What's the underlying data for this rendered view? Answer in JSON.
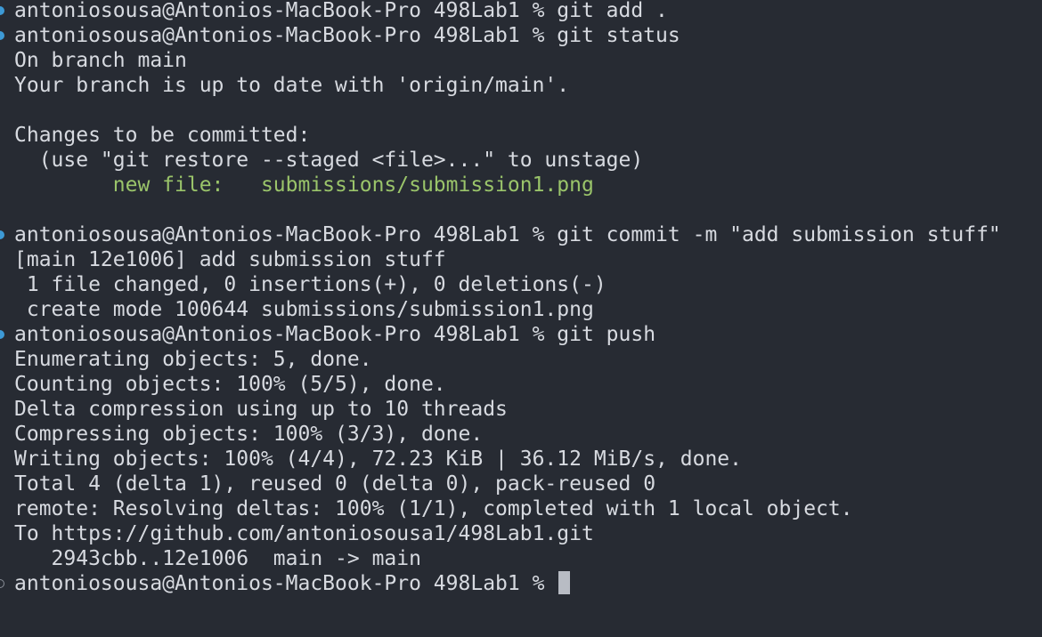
{
  "terminal": {
    "prompt": "antoniosousa@Antonios-MacBook-Pro 498Lab1 % ",
    "lines": [
      "git add .",
      "git status",
      "On branch main",
      "Your branch is up to date with 'origin/main'.",
      "Changes to be committed:",
      "  (use \"git restore --staged <file>...\" to unstage)",
      "        new file:   submissions/submission1.png",
      "git commit -m \"add submission stuff\"",
      "[main 12e1006] add submission stuff",
      " 1 file changed, 0 insertions(+), 0 deletions(-)",
      " create mode 100644 submissions/submission1.png",
      "git push",
      "Enumerating objects: 5, done.",
      "Counting objects: 100% (5/5), done.",
      "Delta compression using up to 10 threads",
      "Compressing objects: 100% (3/3), done.",
      "Writing objects: 100% (4/4), 72.23 KiB | 36.12 MiB/s, done.",
      "Total 4 (delta 1), reused 0 (delta 0), pack-reused 0",
      "remote: Resolving deltas: 100% (1/1), completed with 1 local object.",
      "To https://github.com/antoniosousa1/498Lab1.git",
      "   2943cbb..12e1006  main -> main"
    ],
    "colors": {
      "background": "#272b33",
      "text": "#d7dae0",
      "staged_file": "#9ac46a",
      "command_marker": "#3d9ad6",
      "cursor": "#b8bcc4"
    },
    "icons": {
      "command_marker": "filled-circle",
      "pending_marker": "hollow-circle"
    }
  }
}
